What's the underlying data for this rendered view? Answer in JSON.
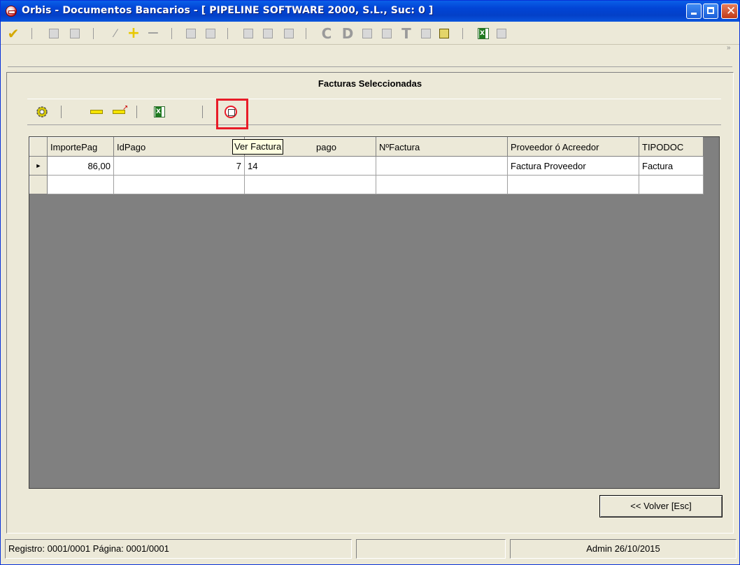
{
  "window": {
    "title": "Orbis - Documentos Bancarios - [ PIPELINE SOFTWARE 2000, S.L., Suc: 0 ]",
    "accent": "#0245D6"
  },
  "toolbar_main": {
    "icons": [
      "check-icon",
      "import-icon",
      "export-icon",
      "edit-icon",
      "add-icon",
      "remove-icon",
      "photo-icon",
      "brush-icon",
      "folder-icon",
      "new-doc-icon",
      "open-icon",
      "c-letter-icon",
      "d-letter-icon",
      "doc-icon",
      "doc2-icon",
      "t-letter-icon",
      "window-icon",
      "report-icon",
      "excel-icon",
      "list-icon"
    ],
    "c_label": "C",
    "d_label": "D",
    "t_label": "T"
  },
  "panel": {
    "title": "Facturas Seleccionadas"
  },
  "grid": {
    "columns": [
      "ImportePag",
      "IdPago",
      "Ver Factura",
      "pago",
      "NºFactura",
      "Proveedor ó Acreedor",
      "TIPODOC"
    ],
    "rows": [
      [
        "86,00",
        "7",
        "14",
        "",
        "Factura Proveedor",
        "Factura"
      ]
    ],
    "current_row_marker": "►"
  },
  "tooltip": "Ver Factura",
  "buttons": {
    "volver": "<< Volver  [Esc]"
  },
  "status": {
    "record": "Registro: 0001/0001  Página: 0001/0001",
    "middle": "",
    "user_date": "Admin 26/10/2015"
  },
  "highlight_color": "#E81C28"
}
